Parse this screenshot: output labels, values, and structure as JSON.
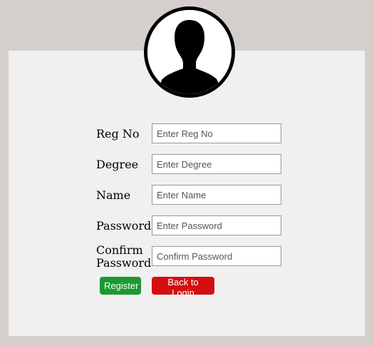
{
  "form": {
    "fields": [
      {
        "label": "Reg No",
        "placeholder": "Enter Reg No",
        "value": ""
      },
      {
        "label": "Degree",
        "placeholder": "Enter Degree",
        "value": ""
      },
      {
        "label": "Name",
        "placeholder": "Enter Name",
        "value": ""
      },
      {
        "label": "Password",
        "placeholder": "Enter Password",
        "value": ""
      },
      {
        "label_line1": "Confirm",
        "label_line2": "Password",
        "placeholder": "Confirm Password",
        "value": ""
      }
    ],
    "register_label": "Register",
    "back_label": "Back to Login"
  },
  "icons": {
    "avatar": "user-silhouette-icon"
  },
  "colors": {
    "background": "#d4cfcc",
    "card": "#f0f0f0",
    "register_button": "#1a9a30",
    "back_button": "#d40f0f"
  }
}
